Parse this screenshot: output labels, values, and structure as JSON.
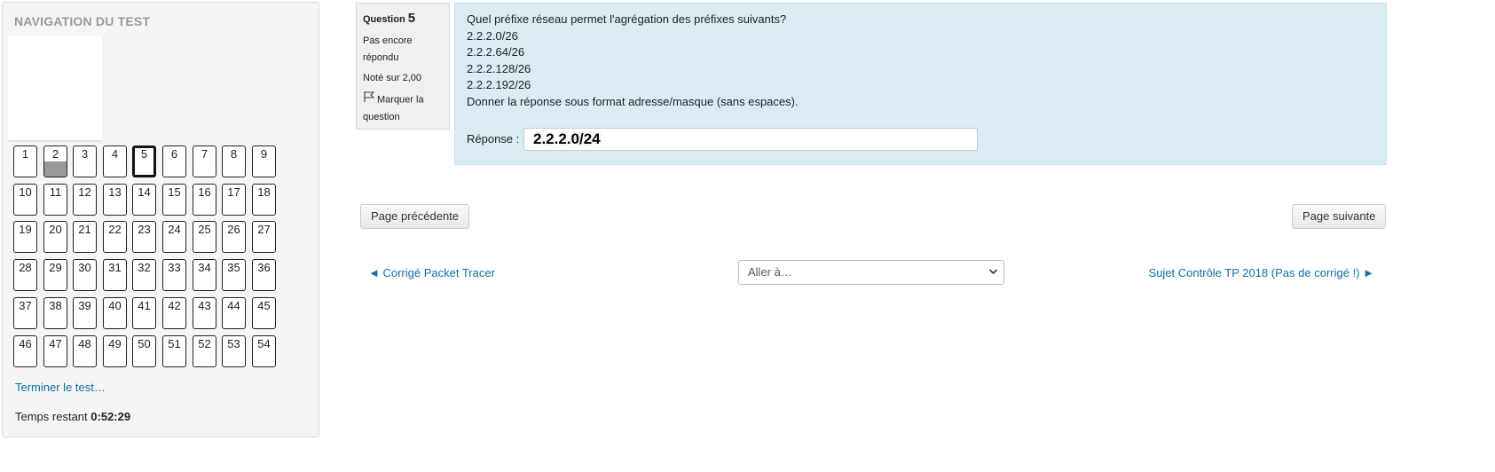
{
  "nav": {
    "title": "NAVIGATION DU TEST",
    "questions": [
      "1",
      "2",
      "3",
      "4",
      "5",
      "6",
      "7",
      "8",
      "9",
      "10",
      "11",
      "12",
      "13",
      "14",
      "15",
      "16",
      "17",
      "18",
      "19",
      "20",
      "21",
      "22",
      "23",
      "24",
      "25",
      "26",
      "27",
      "28",
      "29",
      "30",
      "31",
      "32",
      "33",
      "34",
      "35",
      "36",
      "37",
      "38",
      "39",
      "40",
      "41",
      "42",
      "43",
      "44",
      "45",
      "46",
      "47",
      "48",
      "49",
      "50",
      "51",
      "52",
      "53",
      "54"
    ],
    "current": "5",
    "answered": [
      "2"
    ],
    "finish_label": "Terminer le test…",
    "timer_label": "Temps restant",
    "timer_value": "0:52:29"
  },
  "question": {
    "label": "Question",
    "number": "5",
    "state_line1": "Pas encore",
    "state_line2": "répondu",
    "grade": "Noté sur 2,00",
    "flag_line1": "Marquer la",
    "flag_line2": "question",
    "text_lines": [
      "Quel préfixe réseau permet l'agrégation des préfixes suivants?",
      "2.2.2.0/26",
      "2.2.2.64/26",
      "2.2.2.128/26",
      "2.2.2.192/26",
      "Donner la réponse sous format adresse/masque (sans espaces)."
    ],
    "answer_label": "Réponse :",
    "answer_value": "2.2.2.0/24"
  },
  "buttons": {
    "prev_page": "Page précédente",
    "next_page": "Page suivante"
  },
  "activity_nav": {
    "prev": "◄ Corrigé Packet Tracer",
    "jump_selected": "Aller à…",
    "next": "Sujet Contrôle TP 2018 (Pas de corrigé !) ►"
  }
}
